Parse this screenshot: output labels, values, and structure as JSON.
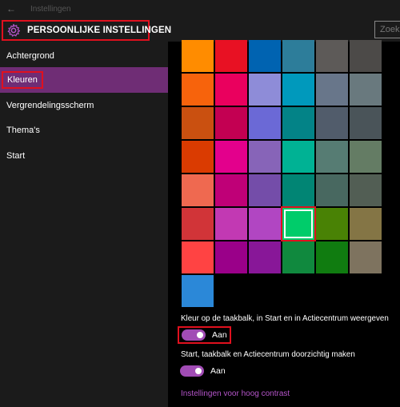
{
  "window": {
    "title": "Instellingen",
    "back_glyph": "←"
  },
  "header": {
    "title": "PERSOONLIJKE INSTELLINGEN",
    "icon": "gear-icon",
    "search_placeholder": "Zoeke"
  },
  "sidebar": {
    "items": [
      {
        "label": "Achtergrond",
        "active": false
      },
      {
        "label": "Kleuren",
        "active": true
      },
      {
        "label": "Vergrendelingsscherm",
        "active": false
      },
      {
        "label": "Thema's",
        "active": false
      },
      {
        "label": "Start",
        "active": false
      }
    ]
  },
  "colors": {
    "accent": "#a14cb5",
    "selected_index": 33,
    "swatches": [
      "#ff8c00",
      "#e81123",
      "#0063b1",
      "#2d7d9a",
      "#5d5a58",
      "#4c4a48",
      "#f7630c",
      "#ea005e",
      "#8e8cd8",
      "#0099bc",
      "#68768a",
      "#69797e",
      "#ca5010",
      "#c30052",
      "#6b69d6",
      "#038387",
      "#515c6b",
      "#4a5459",
      "#da3b01",
      "#e3008c",
      "#8764b8",
      "#00b294",
      "#567c73",
      "#647c64",
      "#ef6950",
      "#bf0077",
      "#744da9",
      "#018574",
      "#486860",
      "#525e54",
      "#d13438",
      "#c239b3",
      "#b146c2",
      "#00cc6a",
      "#498205",
      "#847545",
      "#ff4343",
      "#9a0089",
      "#881798",
      "#10893e",
      "#107c10",
      "#7e735f",
      "#2b88d8"
    ]
  },
  "settings": {
    "taskbar_color": {
      "label": "Kleur op de taakbalk, in Start en in Actiecentrum weergeven",
      "state": "Aan"
    },
    "transparency": {
      "label": "Start, taakbalk en Actiecentrum doorzichtig maken",
      "state": "Aan"
    },
    "high_contrast_link": "Instellingen voor hoog contrast"
  }
}
